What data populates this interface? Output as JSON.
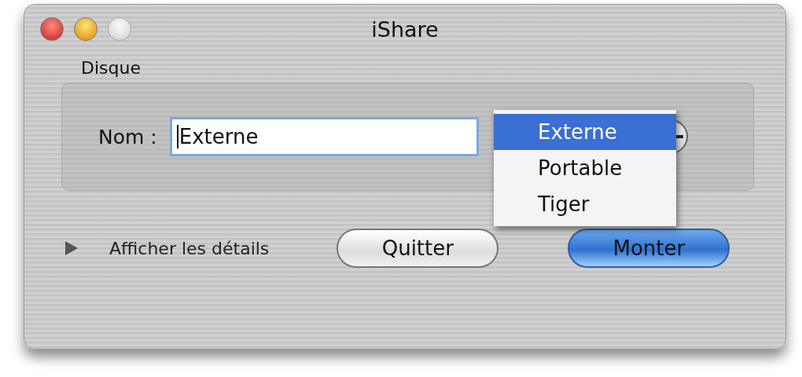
{
  "window": {
    "title": "iShare",
    "controls": [
      {
        "kind": "close",
        "disabled": false
      },
      {
        "kind": "minimize",
        "disabled": false
      },
      {
        "kind": "zoom",
        "disabled": true
      }
    ]
  },
  "group": {
    "title": "Disque",
    "label": "Nom :",
    "value": "Externe"
  },
  "menu": [
    {
      "label": "Externe",
      "selected": true
    },
    {
      "label": "Portable",
      "selected": false
    },
    {
      "label": "Tiger",
      "selected": false
    }
  ],
  "details": {
    "label": "Afficher les détails",
    "expanded": false
  },
  "buttons": [
    {
      "label": "Quitter",
      "default": false
    },
    {
      "label": "Monter",
      "default": true
    }
  ]
}
